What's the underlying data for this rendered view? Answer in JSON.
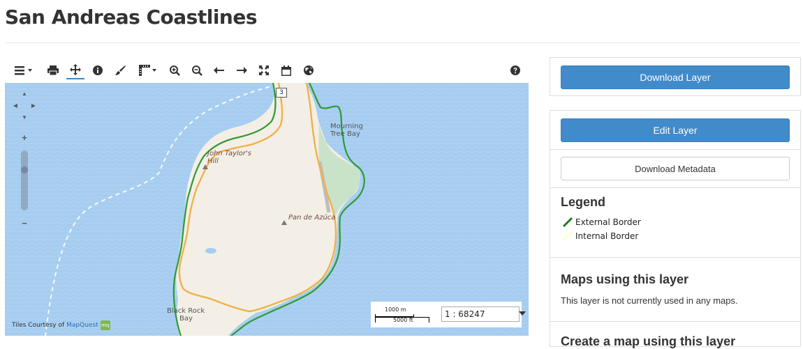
{
  "page": {
    "title": "San Andreas Coastlines"
  },
  "toolbar": {
    "buttons": [
      {
        "icon": "menu-icon",
        "has_dropdown": true
      },
      {
        "icon": "print-icon"
      },
      {
        "icon": "pan-icon",
        "active": true
      },
      {
        "icon": "info-icon"
      },
      {
        "icon": "paint-brush-icon"
      },
      {
        "icon": "measure-icon",
        "has_dropdown": true
      },
      {
        "icon": "zoom-in-icon"
      },
      {
        "icon": "zoom-out-icon"
      },
      {
        "icon": "back-arrow-icon"
      },
      {
        "icon": "forward-arrow-icon"
      },
      {
        "icon": "fullscreen-icon"
      },
      {
        "icon": "calendar-icon"
      },
      {
        "icon": "globe-icon"
      },
      {
        "icon": "help-icon"
      }
    ]
  },
  "map": {
    "road_shield": "3",
    "labels": {
      "mourning_tree_bay": [
        "Mourning",
        "Tree Bay"
      ],
      "john_taylors_hill": [
        "John Taylor's",
        "Hill"
      ],
      "pan_de_azucar": "Pan de Azúca",
      "black_rock_bay": [
        "Black Rock",
        "Bay"
      ]
    },
    "attribution": {
      "prefix": "Tiles Courtesy of",
      "link": "MapQuest"
    },
    "scale": {
      "metric": "1000 m",
      "imperial": "5000 ft",
      "ratio": "1 : 68247"
    },
    "colors": {
      "water": "#a6cdf0",
      "land": "#f4efe6",
      "external_border": "#2d9a34",
      "internal_border": "#f0b14a"
    }
  },
  "sidebar": {
    "download_layer": "Download Layer",
    "edit_layer": "Edit Layer",
    "download_metadata": "Download Metadata",
    "legend": {
      "title": "Legend",
      "items": [
        {
          "label": "External Border",
          "color": "#1e7a1e"
        },
        {
          "label": "Internal Border",
          "color": "#ffffcc"
        }
      ]
    },
    "maps_using": {
      "title": "Maps using this layer",
      "text": "This layer is not currently used in any maps."
    },
    "next_section_title": "Create a map using this layer"
  }
}
